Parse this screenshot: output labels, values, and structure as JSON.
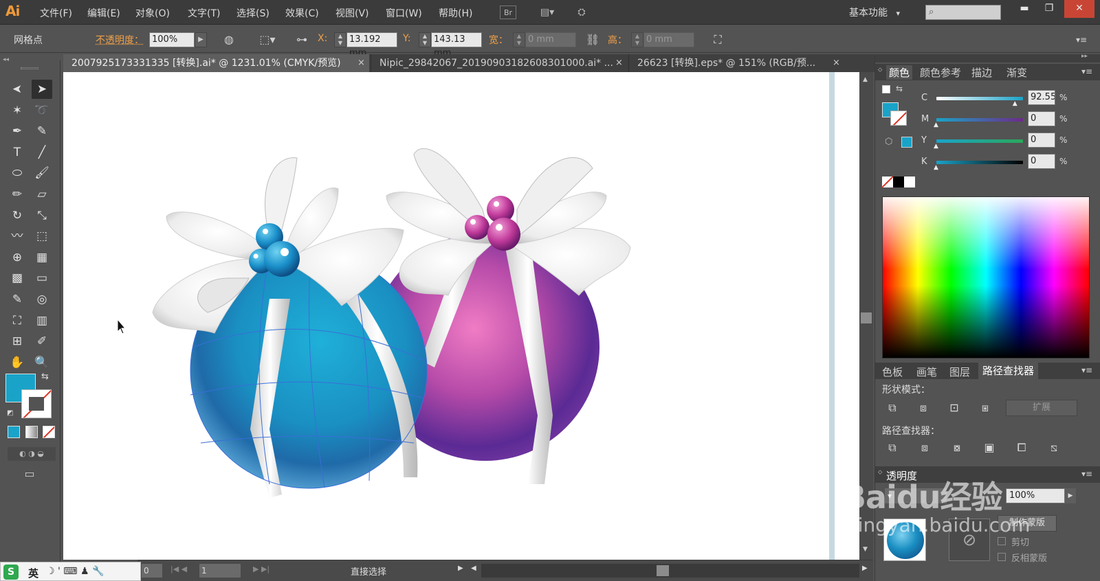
{
  "app": {
    "logo": "Ai"
  },
  "menu": [
    "文件(F)",
    "编辑(E)",
    "对象(O)",
    "文字(T)",
    "选择(S)",
    "效果(C)",
    "视图(V)",
    "窗口(W)",
    "帮助(H)"
  ],
  "menubar_icons": {
    "bridge": "Br",
    "arrange": "▤▾",
    "sync": "⛭"
  },
  "workspace": {
    "label": "基本功能",
    "arrow": "▾",
    "search_icon": "⌕"
  },
  "window_controls": {
    "minimize": "▬",
    "restore": "❐",
    "close": "✕"
  },
  "control_bar": {
    "selection_label": "网格点",
    "opacity_label": "不透明度：",
    "opacity_value": "100%",
    "x_label": "X:",
    "x_value": "13.192 mm",
    "y_label": "Y:",
    "y_value": "143.13 mm",
    "width_label": "宽：",
    "width_value": "0 mm",
    "height_label": "高：",
    "height_value": "0 mm"
  },
  "tabs": [
    {
      "label": "2007925173331335 [转换].ai* @ 1231.01% (CMYK/预览)",
      "close": "×",
      "active": true
    },
    {
      "label": "Nipic_29842067_20190903182608301000.ai* ...",
      "close": "×",
      "active": false
    },
    {
      "label": "26623 [转换].eps* @ 151% (RGB/预...",
      "close": "×",
      "active": false
    }
  ],
  "tools": [
    {
      "name": "selection-tool",
      "glyph": "➤"
    },
    {
      "name": "direct-selection-tool",
      "glyph": "➤"
    },
    {
      "name": "magic-wand-tool",
      "glyph": "✶"
    },
    {
      "name": "lasso-tool",
      "glyph": "➰"
    },
    {
      "name": "pen-tool",
      "glyph": "✒"
    },
    {
      "name": "curvature-tool",
      "glyph": "✎"
    },
    {
      "name": "type-tool",
      "glyph": "T"
    },
    {
      "name": "line-tool",
      "glyph": "╱"
    },
    {
      "name": "ellipse-tool",
      "glyph": "⬭"
    },
    {
      "name": "paintbrush-tool",
      "glyph": "🖌"
    },
    {
      "name": "pencil-tool",
      "glyph": "✏"
    },
    {
      "name": "eraser-tool",
      "glyph": "▱"
    },
    {
      "name": "rotate-tool",
      "glyph": "↻"
    },
    {
      "name": "scale-tool",
      "glyph": "⤡"
    },
    {
      "name": "warp-tool",
      "glyph": "〰"
    },
    {
      "name": "free-transform-tool",
      "glyph": "⬚"
    },
    {
      "name": "shape-builder-tool",
      "glyph": "⊕"
    },
    {
      "name": "perspective-grid-tool",
      "glyph": "▦"
    },
    {
      "name": "mesh-tool",
      "glyph": "▩"
    },
    {
      "name": "gradient-tool",
      "glyph": "▭"
    },
    {
      "name": "eyedropper-tool",
      "glyph": "✎"
    },
    {
      "name": "blend-tool",
      "glyph": "◎"
    },
    {
      "name": "symbol-sprayer-tool",
      "glyph": "⛶"
    },
    {
      "name": "column-graph-tool",
      "glyph": "▥"
    },
    {
      "name": "artboard-tool",
      "glyph": "⊞"
    },
    {
      "name": "slice-tool",
      "glyph": "✐"
    },
    {
      "name": "hand-tool",
      "glyph": "✋"
    },
    {
      "name": "zoom-tool",
      "glyph": "🔍"
    }
  ],
  "color_panel": {
    "tabs": [
      "颜色",
      "颜色参考",
      "描边",
      "渐变"
    ],
    "channels": [
      {
        "label": "C",
        "value": "92.55",
        "unit": "%"
      },
      {
        "label": "M",
        "value": "0",
        "unit": "%"
      },
      {
        "label": "Y",
        "value": "0",
        "unit": "%"
      },
      {
        "label": "K",
        "value": "0",
        "unit": "%"
      }
    ],
    "fill_color": "#1aa3c8"
  },
  "pathfinder_panel": {
    "tabs": [
      "色板",
      "画笔",
      "图层",
      "路径查找器"
    ],
    "shape_modes_label": "形状模式：",
    "expand_label": "扩展",
    "pathfinders_label": "路径查找器："
  },
  "transparency_panel": {
    "title": "透明度",
    "opacity_value": "100%",
    "make_mask_label": "制作蒙版",
    "clip_label": "剪切",
    "invert_label": "反相蒙版"
  },
  "status": {
    "zoom_value": "0",
    "page_value": "1",
    "tool_name": "直接选择"
  },
  "ime": {
    "logo": "S",
    "lang": "英",
    "icons": "☽ ' ⌨ ♟ 🔧"
  },
  "watermark": {
    "brand": "Baidu经验",
    "url": "jingyan.baidu.com"
  }
}
